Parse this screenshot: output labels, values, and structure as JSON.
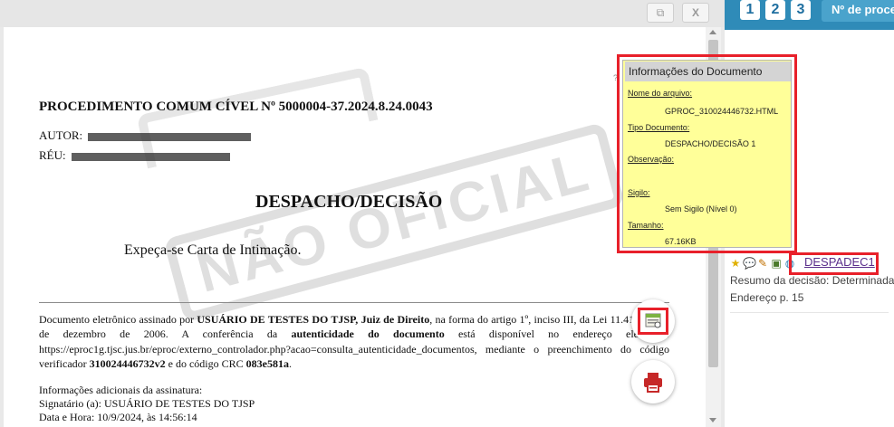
{
  "background": {
    "page_buttons": [
      "1",
      "2",
      "3"
    ],
    "process_button": "Nº de proce",
    "document_link": "DESPADEC1",
    "summary": "Resumo da decisão: Determinada",
    "address": "Endereço p. 15"
  },
  "modal": {
    "header_buttons": {
      "popout_label": "⧉",
      "close_label": "X"
    },
    "document": {
      "process_title": "PROCEDIMENTO COMUM CÍVEL Nº 5000004-37.2024.8.24.0043",
      "author_label": "AUTOR:",
      "defendant_label": "RÉU:",
      "heading": "DESPACHO/DECISÃO",
      "body": "Expeça-se Carta de Intimação.",
      "signature": {
        "part1": "Documento eletrônico assinado por ",
        "signer": "USUÁRIO DE TESTES DO TJSP, Juiz de Direito",
        "part2": ", na forma do artigo 1º, inciso III, da Lei 11.419, de 19 de dezembro de 2006. A conferência da ",
        "authenticity": "autenticidade do documento",
        "part3": " está disponível no endereço eletrônico https://eproc1g.tjsc.jus.br/eproc/externo_controlador.php?acao=consulta_autenticidade_documentos, mediante o preenchimento do código verificador ",
        "verifier_code": "310024446732v2",
        "part4": " e do código CRC ",
        "crc_code": "083e581a",
        "part5": "."
      },
      "additional_info": {
        "title": "Informações adicionais da assinatura:",
        "signer_line": "Signatário (a): USUÁRIO DE TESTES DO TJSP",
        "datetime_line": "Data e Hora: 10/9/2024, às 14:56:14"
      },
      "watermark": "NÃO OFICIAL"
    },
    "tooltip": {
      "title": "Informações do Documento",
      "file_name_label": "Nome do arquivo:",
      "file_name": "GPROC_310024446732.HTML",
      "doc_type_label": "Tipo Documento:",
      "doc_type": "DESPACHO/DECISÃO 1",
      "observation_label": "Observação:",
      "secrecy_label": "Sigilo:",
      "secrecy": "Sem Sigilo (Nível 0)",
      "size_label": "Tamanho:",
      "size": "67.16KB"
    }
  },
  "colors": {
    "highlight": "#e8202a",
    "tooltip_bg": "#ffff99",
    "topbar": "#2f8bb8",
    "link": "#5b2f8c"
  }
}
